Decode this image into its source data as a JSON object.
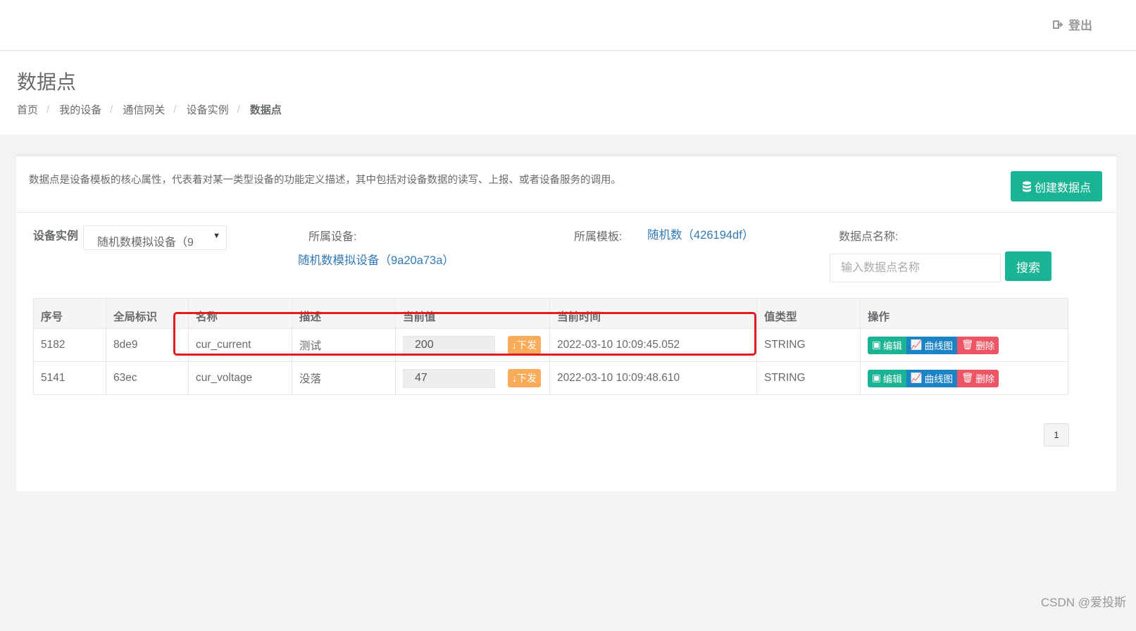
{
  "topbar": {
    "logout_label": "登出"
  },
  "header": {
    "title": "数据点",
    "breadcrumb": [
      "首页",
      "我的设备",
      "通信网关",
      "设备实例",
      "数据点"
    ]
  },
  "card": {
    "description": "数据点是设备模板的核心属性，代表着对某一类型设备的功能定义描述，其中包括对设备数据的读写、上报、或者设备服务的调用。",
    "create_button": "创建数据点"
  },
  "filters": {
    "instance_label": "设备实例",
    "instance_value": "随机数模拟设备（9",
    "device_label": "所属设备:",
    "device_value": "随机数模拟设备（9a20a73a）",
    "template_label": "所属模板:",
    "template_value": "随机数（426194df）",
    "name_label": "数据点名称:",
    "name_placeholder": "输入数据点名称",
    "search_button": "搜索"
  },
  "table": {
    "headers": [
      "序号",
      "全局标识",
      "名称",
      "描述",
      "当前值",
      "当前时间",
      "值类型",
      "操作"
    ],
    "rows": [
      {
        "id": "5182",
        "gid": "8de9",
        "name": "cur_current",
        "desc": "测试",
        "value": "200",
        "send": "下发",
        "time": "2022-03-10 10:09:45.052",
        "type": "STRING"
      },
      {
        "id": "5141",
        "gid": "63ec",
        "name": "cur_voltage",
        "desc": "没落",
        "value": "47",
        "send": "下发",
        "time": "2022-03-10 10:09:48.610",
        "type": "STRING"
      }
    ],
    "actions": {
      "edit": "编辑",
      "curve": "曲线图",
      "delete": "删除"
    }
  },
  "pagination": {
    "current": "1"
  },
  "watermark": "CSDN @爱投斯",
  "colors": {
    "primary": "#1ab394",
    "info": "#1c84c6",
    "danger": "#ed5565",
    "warning": "#f8ac59",
    "highlight": "#e21d1d"
  }
}
